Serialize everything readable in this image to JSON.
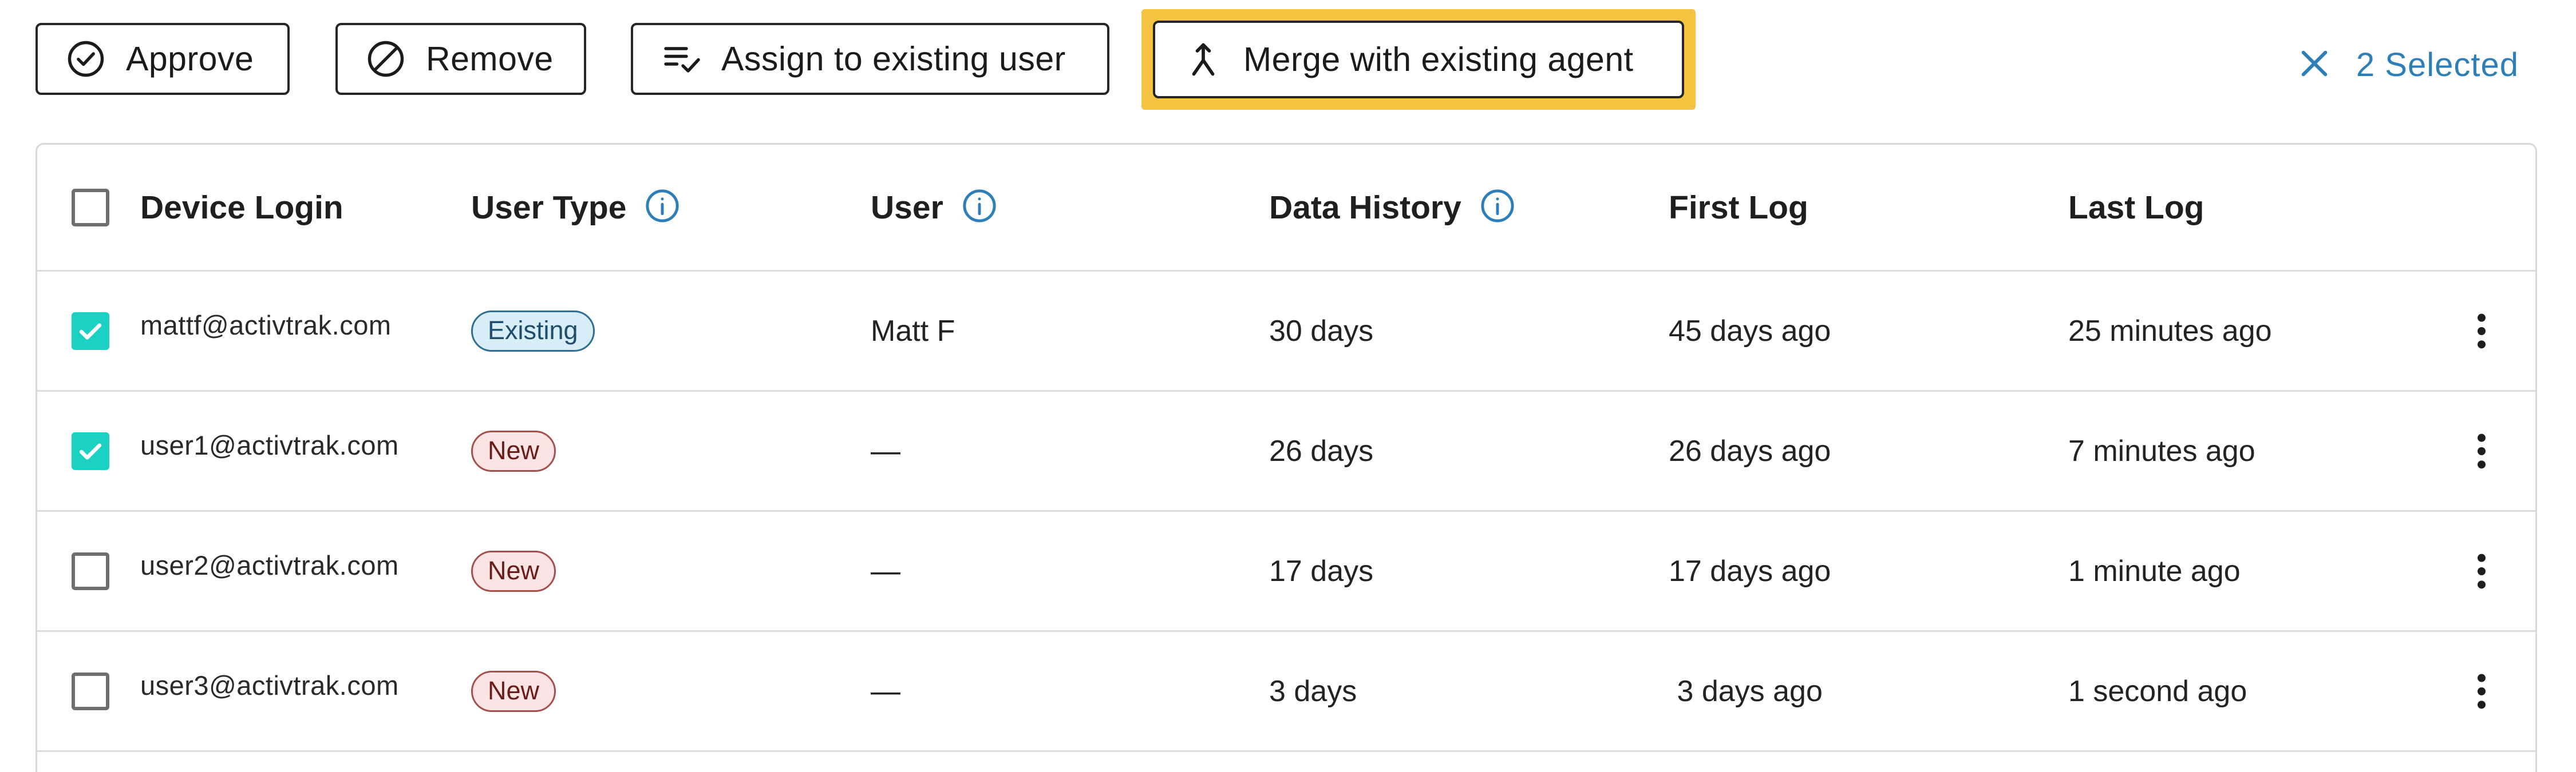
{
  "toolbar": {
    "approve_label": "Approve",
    "remove_label": "Remove",
    "assign_label": "Assign to existing user",
    "merge_label": "Merge with existing agent",
    "selected_label": "2 Selected"
  },
  "colors": {
    "accent_teal": "#1ad1c2",
    "link_blue": "#2e7fb8",
    "highlight_yellow": "#f5c342",
    "badge_existing_bg": "#d7eef7",
    "badge_new_bg": "#fbe4e3"
  },
  "icons": {
    "approve": "check-circle-icon",
    "remove": "block-icon",
    "assign": "playlist-check-icon",
    "merge": "merge-arrow-icon",
    "clear": "close-icon",
    "info": "info-circle-icon",
    "row_menu": "more-vertical-icon"
  },
  "table": {
    "columns": [
      "Device Login",
      "User Type",
      "User",
      "Data History",
      "First Log",
      "Last Log"
    ],
    "rows": [
      {
        "checked": true,
        "login": "mattf@activtrak.com",
        "type": "Existing",
        "type_kind": "existing",
        "user": "Matt F",
        "history": "30 days",
        "first": "45 days ago",
        "last": "25 minutes ago"
      },
      {
        "checked": true,
        "login": "user1@activtrak.com",
        "type": "New",
        "type_kind": "new",
        "user": "—",
        "history": "26 days",
        "first": "26 days ago",
        "last": "7 minutes ago"
      },
      {
        "checked": false,
        "login": "user2@activtrak.com",
        "type": "New",
        "type_kind": "new",
        "user": "—",
        "history": "17 days",
        "first": "17 days ago",
        "last": "1 minute ago"
      },
      {
        "checked": false,
        "login": "user3@activtrak.com",
        "type": "New",
        "type_kind": "new",
        "user": "—",
        "history": "3 days",
        "first": " 3 days ago",
        "last": "1 second ago"
      }
    ]
  }
}
